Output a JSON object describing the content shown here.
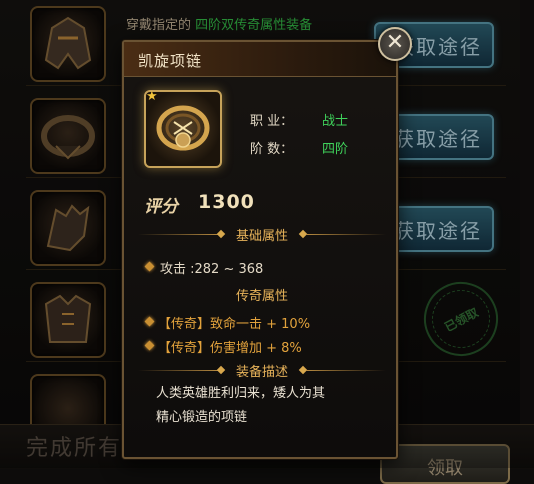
{
  "quest": {
    "row1_prefix": "穿戴指定的",
    "row1_highlight": "四阶双传奇属性装备",
    "acquire_label": "获取途径",
    "claimed_stamp": "已领取",
    "complete_all": "完成所有任务",
    "claim_label": "领取"
  },
  "tooltip": {
    "title": "凯旋项链",
    "close_glyph": "✕",
    "star_glyph": "★",
    "job_label": "职 业：",
    "job_value": "战士",
    "tier_label": "阶 数：",
    "tier_value": "四阶",
    "score_label": "评分",
    "score_value": "1300",
    "base_header": "基础属性",
    "attack_line": "攻击 :282 ~ 368",
    "legend_header": "传奇属性",
    "legend_lines": [
      "【传奇】致命一击 + 10%",
      "【传奇】伤害增加 + 8%"
    ],
    "desc_header": "装备描述",
    "desc_lines": [
      "人类英雄胜利归来，矮人为其",
      "精心锻造的项链"
    ]
  },
  "icons": {
    "slot1": "helmet-icon",
    "slot2": "necklace-icon",
    "slot3": "gauntlet-icon",
    "slot4": "armor-icon",
    "item": "necklace-icon"
  }
}
